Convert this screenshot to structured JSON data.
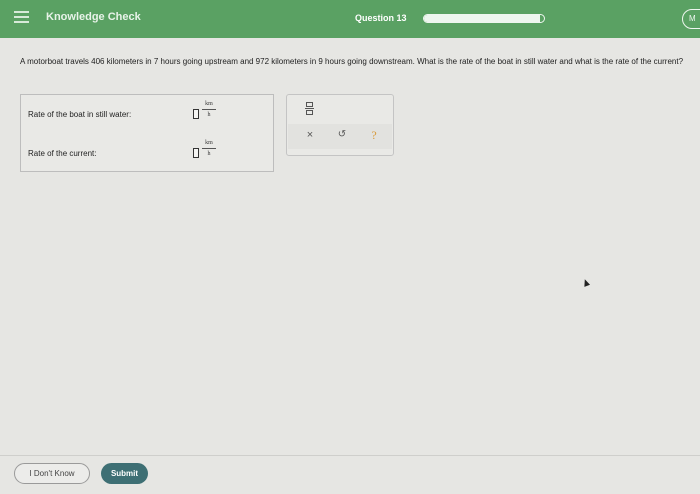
{
  "header": {
    "title": "Knowledge Check",
    "question_label": "Question 13",
    "progress_fraction": 0.97,
    "user_initials": "M"
  },
  "problem": {
    "text": "A motorboat travels 406 kilometers in 7 hours going upstream and 972 kilometers in 9 hours going downstream. What is the rate of the boat in still water and what is the rate of the current?"
  },
  "answers": {
    "rows": [
      {
        "label": "Rate of the boat in still water:",
        "unit_numerator": "km",
        "unit_denominator": "h",
        "value": ""
      },
      {
        "label": "Rate of the current:",
        "unit_numerator": "km",
        "unit_denominator": "h",
        "value": ""
      }
    ]
  },
  "toolpad": {
    "fraction_icon": "fraction-template-icon",
    "clear_glyph": "×",
    "undo_glyph": "↺",
    "help_glyph": "?"
  },
  "footer": {
    "dont_know_label": "I Don't Know",
    "submit_label": "Submit"
  },
  "colors": {
    "header_green": "#5aa163",
    "submit_teal": "#3e6f74",
    "help_orange": "#d89a3a"
  }
}
